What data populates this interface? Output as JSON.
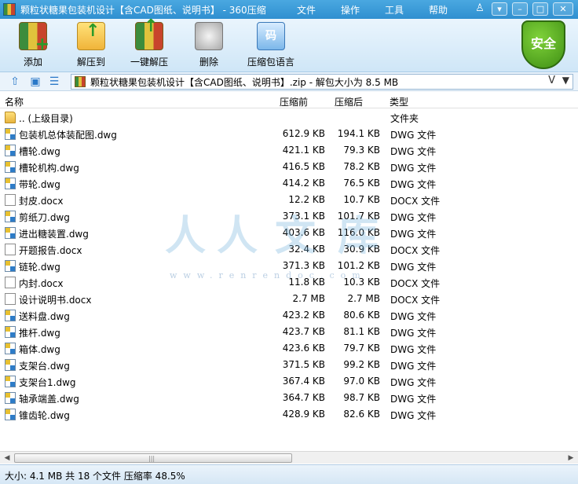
{
  "window": {
    "title": "颗粒状糖果包装机设计【含CAD图纸、说明书】 - 360压缩",
    "menus": [
      "文件",
      "操作",
      "工具",
      "帮助"
    ]
  },
  "toolbar": {
    "buttons": [
      {
        "label": "添加",
        "icon": "add-archive-icon"
      },
      {
        "label": "解压到",
        "icon": "extract-to-icon"
      },
      {
        "label": "一键解压",
        "icon": "one-click-extract-icon"
      },
      {
        "label": "删除",
        "icon": "delete-icon"
      },
      {
        "label": "压缩包语言",
        "icon": "archive-language-icon"
      }
    ],
    "code_glyph": "码",
    "security_badge": "安全"
  },
  "address": {
    "path": "颗粒状糖果包装机设计【含CAD图纸、说明书】.zip - 解包大小为 8.5 MB"
  },
  "columns": {
    "name": "名称",
    "before": "压缩前",
    "after": "压缩后",
    "type": "类型"
  },
  "files": [
    {
      "name": ".. (上级目录)",
      "before": "",
      "after": "",
      "type": "文件夹",
      "kind": "folder"
    },
    {
      "name": "包装机总体装配图.dwg",
      "before": "612.9 KB",
      "after": "194.1 KB",
      "type": "DWG 文件",
      "kind": "dwg"
    },
    {
      "name": "槽轮.dwg",
      "before": "421.1 KB",
      "after": "79.3 KB",
      "type": "DWG 文件",
      "kind": "dwg"
    },
    {
      "name": "槽轮机构.dwg",
      "before": "416.5 KB",
      "after": "78.2 KB",
      "type": "DWG 文件",
      "kind": "dwg"
    },
    {
      "name": "带轮.dwg",
      "before": "414.2 KB",
      "after": "76.5 KB",
      "type": "DWG 文件",
      "kind": "dwg"
    },
    {
      "name": "封皮.docx",
      "before": "12.2 KB",
      "after": "10.7 KB",
      "type": "DOCX 文件",
      "kind": "docx"
    },
    {
      "name": "剪纸刀.dwg",
      "before": "373.1 KB",
      "after": "101.7 KB",
      "type": "DWG 文件",
      "kind": "dwg"
    },
    {
      "name": "进出糖装置.dwg",
      "before": "403.6 KB",
      "after": "116.0 KB",
      "type": "DWG 文件",
      "kind": "dwg"
    },
    {
      "name": "开题报告.docx",
      "before": "32.4 KB",
      "after": "30.9 KB",
      "type": "DOCX 文件",
      "kind": "docx"
    },
    {
      "name": "链轮.dwg",
      "before": "371.3 KB",
      "after": "101.2 KB",
      "type": "DWG 文件",
      "kind": "dwg"
    },
    {
      "name": "内封.docx",
      "before": "11.8 KB",
      "after": "10.3 KB",
      "type": "DOCX 文件",
      "kind": "docx"
    },
    {
      "name": "设计说明书.docx",
      "before": "2.7 MB",
      "after": "2.7 MB",
      "type": "DOCX 文件",
      "kind": "docx"
    },
    {
      "name": "送料盘.dwg",
      "before": "423.2 KB",
      "after": "80.6 KB",
      "type": "DWG 文件",
      "kind": "dwg"
    },
    {
      "name": "推杆.dwg",
      "before": "423.7 KB",
      "after": "81.1 KB",
      "type": "DWG 文件",
      "kind": "dwg"
    },
    {
      "name": "箱体.dwg",
      "before": "423.6 KB",
      "after": "79.7 KB",
      "type": "DWG 文件",
      "kind": "dwg"
    },
    {
      "name": "支架台.dwg",
      "before": "371.5 KB",
      "after": "99.2 KB",
      "type": "DWG 文件",
      "kind": "dwg"
    },
    {
      "name": "支架台1.dwg",
      "before": "367.4 KB",
      "after": "97.0 KB",
      "type": "DWG 文件",
      "kind": "dwg"
    },
    {
      "name": "轴承端盖.dwg",
      "before": "364.7 KB",
      "after": "98.7 KB",
      "type": "DWG 文件",
      "kind": "dwg"
    },
    {
      "name": "锥齿轮.dwg",
      "before": "428.9 KB",
      "after": "82.6 KB",
      "type": "DWG 文件",
      "kind": "dwg"
    }
  ],
  "watermark": {
    "chars": [
      "人",
      "人",
      "文",
      "库"
    ],
    "url": "www.renrendoc.com"
  },
  "status": {
    "text": "大小: 4.1 MB 共 18 个文件 压缩率 48.5%"
  }
}
